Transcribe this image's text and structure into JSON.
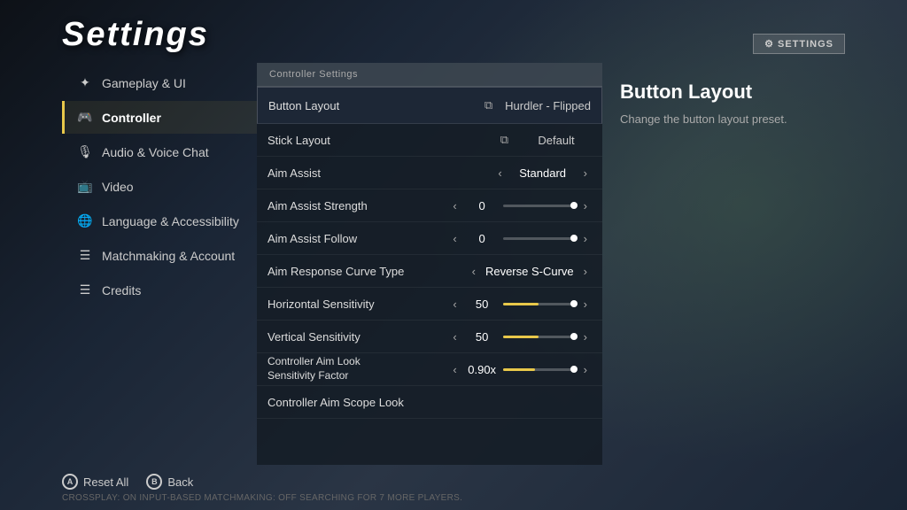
{
  "header": {
    "title": "Settings",
    "badge": "⚙ SETTINGS"
  },
  "sidebar": {
    "items": [
      {
        "id": "gameplay-ui",
        "label": "Gameplay & UI",
        "icon": "✦",
        "active": false
      },
      {
        "id": "controller",
        "label": "Controller",
        "icon": "🎮",
        "active": true
      },
      {
        "id": "audio-voice",
        "label": "Audio & Voice Chat",
        "icon": "🎙",
        "active": false
      },
      {
        "id": "video",
        "label": "Video",
        "icon": "📺",
        "active": false
      },
      {
        "id": "language",
        "label": "Language & Accessibility",
        "icon": "🌐",
        "active": false
      },
      {
        "id": "matchmaking",
        "label": "Matchmaking & Account",
        "icon": "☰",
        "active": false
      },
      {
        "id": "credits",
        "label": "Credits",
        "icon": "☰",
        "active": false
      }
    ]
  },
  "panel": {
    "header": "Controller Settings",
    "rows": [
      {
        "id": "button-layout",
        "label": "Button Layout",
        "value": "Hurdler - Flipped",
        "type": "external",
        "isTop": true
      },
      {
        "id": "stick-layout",
        "label": "Stick Layout",
        "value": "Default",
        "type": "external"
      },
      {
        "id": "aim-assist",
        "label": "Aim Assist",
        "value": "Standard",
        "type": "arrows"
      },
      {
        "id": "aim-assist-strength",
        "label": "Aim Assist Strength",
        "value": "0",
        "type": "slider",
        "fill": 0
      },
      {
        "id": "aim-assist-follow",
        "label": "Aim Assist Follow",
        "value": "0",
        "type": "slider",
        "fill": 0
      },
      {
        "id": "aim-response-curve",
        "label": "Aim Response Curve Type",
        "value": "Reverse S-Curve",
        "type": "arrows"
      },
      {
        "id": "horizontal-sensitivity",
        "label": "Horizontal Sensitivity",
        "value": "50",
        "type": "slider",
        "fill": 50
      },
      {
        "id": "vertical-sensitivity",
        "label": "Vertical Sensitivity",
        "value": "50",
        "type": "slider",
        "fill": 50
      },
      {
        "id": "aim-look-factor",
        "label": "Controller Aim Look\nSensitivity Factor",
        "value": "0.90x",
        "type": "slider-two",
        "fill": 45
      },
      {
        "id": "aim-scope-look",
        "label": "Controller Aim Scope Look",
        "value": "",
        "type": "partial"
      }
    ]
  },
  "info": {
    "title": "Button Layout",
    "description": "Change the button layout preset."
  },
  "footer": {
    "reset_label": "Reset All",
    "back_label": "Back",
    "status": "CROSSPLAY: ON  INPUT-BASED MATCHMAKING: OFF  SEARCHING FOR 7 MORE PLAYERS."
  }
}
